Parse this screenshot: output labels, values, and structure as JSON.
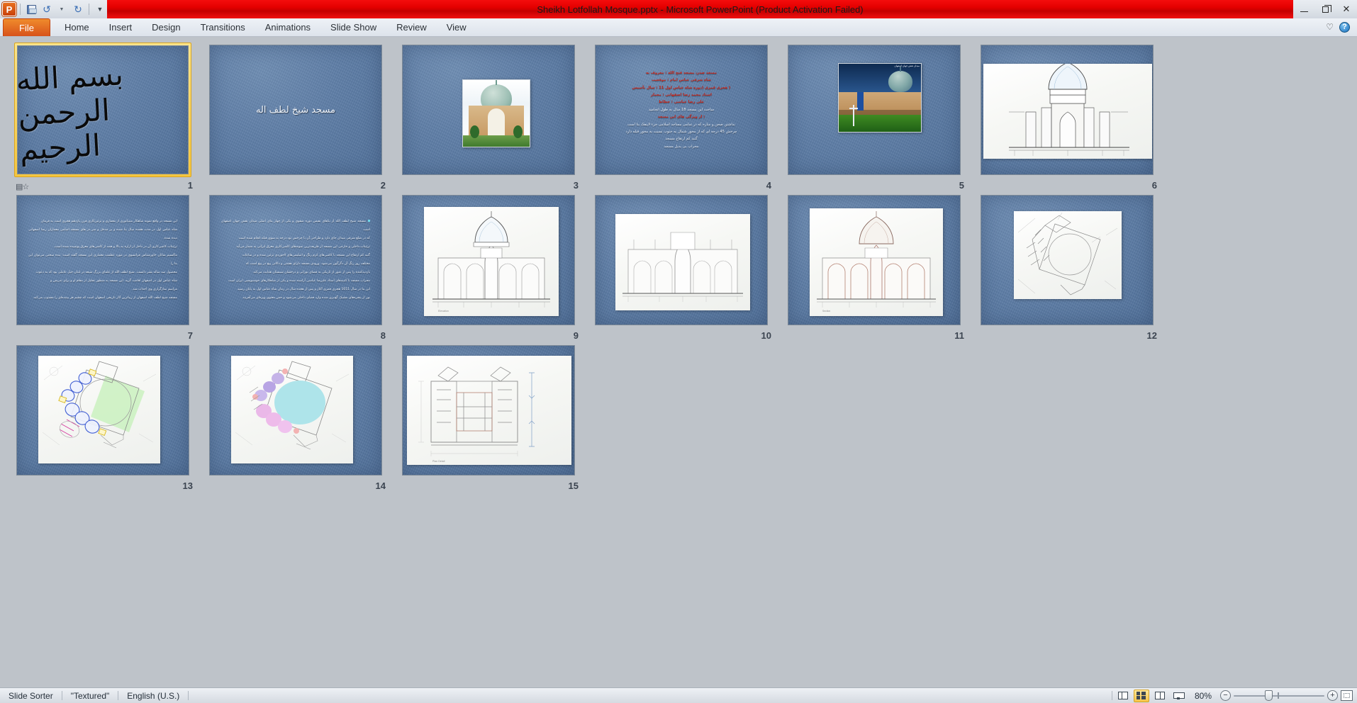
{
  "window": {
    "title": "Sheikh Lotfollah Mosque.pptx  -  Microsoft PowerPoint (Product Activation Failed)",
    "minimize_label": "Minimize",
    "restore_label": "Restore Down",
    "close_label": "Close",
    "titlebar_color": "#e40000"
  },
  "quick_access": {
    "logo_label": "P",
    "items": [
      {
        "name": "save-button",
        "label": "Save"
      },
      {
        "name": "undo-button",
        "label": "Undo"
      },
      {
        "name": "undo-dropdown",
        "label": "Undo options"
      },
      {
        "name": "repeat-button",
        "label": "Repeat"
      },
      {
        "name": "customize-qat-button",
        "label": "Customize Quick Access Toolbar"
      }
    ]
  },
  "ribbon": {
    "tabs": [
      {
        "label": "File",
        "active": false,
        "file": true
      },
      {
        "label": "Home",
        "active": false
      },
      {
        "label": "Insert",
        "active": false
      },
      {
        "label": "Design",
        "active": false
      },
      {
        "label": "Transitions",
        "active": false
      },
      {
        "label": "Animations",
        "active": false
      },
      {
        "label": "Slide Show",
        "active": false
      },
      {
        "label": "Review",
        "active": false
      },
      {
        "label": "View",
        "active": false
      }
    ],
    "minimize_ribbon_label": "Minimize the Ribbon",
    "help_label": "?"
  },
  "slides": [
    {
      "number": "1",
      "selected": true,
      "kind": "calligraphy",
      "text": "بسم الله الرحمن الرحیم",
      "has_animation": true
    },
    {
      "number": "2",
      "selected": false,
      "kind": "title",
      "text": "مسجد شیخ لطف اله"
    },
    {
      "number": "3",
      "selected": false,
      "kind": "photo-mosque",
      "text": ""
    },
    {
      "number": "4",
      "selected": false,
      "kind": "bullets-red",
      "lines": [
        {
          "text": "مسجد صدر، مسجد فتح الله : معروف به",
          "accent": "معروف به"
        },
        {
          "text": "شاه شرفی عباس امام : موقعیت",
          "accent": "موقعیت"
        },
        {
          "text": "( هجری قمری (دوره شاه عباس اول 11 : سال تأسیس",
          "accent": "سال تأسیس"
        },
        {
          "text": "استاد محمد رضا اصفهانی : معمار",
          "accent": "معمار"
        },
        {
          "text": "علی رضا عباسی : خطاط",
          "accent": "خطاط"
        },
        {
          "text": "ساخت این مسجد 18 سال به طول انجامید",
          "accent": ""
        },
        {
          "text": ": از ویژگی های این مسجد",
          "accent": ": از ویژگی های این مسجد"
        },
        {
          "text": "نداشتن صحن و مناره که در تمامی مساجد اسلامی جزء لاینفک بنا است",
          "accent": ""
        },
        {
          "text": "چرخش 45 درجه ای که از محور شمال به جنوب نسبت به محور قبله دارد",
          "accent": ""
        },
        {
          "text": "گنبد کم ارتفاع مسجد",
          "accent": ""
        },
        {
          "text": "محراب بی بدیل مسجد",
          "accent": ""
        }
      ]
    },
    {
      "number": "5",
      "selected": false,
      "kind": "photo-square",
      "caption": "میدان نقش جهان اصفهان"
    },
    {
      "number": "6",
      "selected": false,
      "kind": "drawing-elevation"
    },
    {
      "number": "7",
      "selected": false,
      "kind": "paragraph",
      "lines": [
        "این مسجد در واقع نمونه شاهکار مینیاتوری از معماری و تزئین‌کاری قرن یازدهم هجری است به فرمان",
        "شاه عباس اول در مدت هجده سال بنا شده و بر مدخل و سر در های مسجد اسامی معماران رضا اصفهانی دیده شده.",
        "تزئینات کاشی‌کاری آن در داخل از ازاره به بالا و همه از کاشی‌های معرق پوشیده شده است.",
        "ماکسیم شاتان خاورشناس فرانسوی در مورد عظمت معماری این مسجد گفته است: بنده سخنی می‌توان این بنا را",
        "محصول صد ساله بشر دانست. شیخ لطف الله از علمای بزرگ شیعه در لبنان جبل عاملی بود که به دعوت",
        "شاه عباس اول در اصفهان اقامت گزید. این مسجد به منظور تجلیل از مقام او و برای تدریس و",
        "مراسم نمازگزاری وی احداث شد.",
        "مسجد شیخ لطف الله اصفهان از زیباترین آثار تاریخی اصفهان است که چشم هر بیننده‌ای را مجذوب می‌کند."
      ]
    },
    {
      "number": "8",
      "selected": false,
      "kind": "paragraph-dense",
      "lines": [
        "مسجد شیخ لطف الله از بناهای نفیس دوره صفوی و یکی از چهار بنای اصلی میدان نقش جهان اصفهان است",
        "که در ضلع شرقی میدان جای دارد و طراحی آن با چرخش نود درجه به سوی قبله انجام شده است",
        "تزئینات داخلی و خارجی این مسجد از ظریف‌ترین نمونه‌های کاشی‌کاری معرق ایرانی به شمار می‌آید",
        "گنبد کم ارتفاع این مسجد با کاشی‌های کرم رنگ و اسلیمی‌های لاجوردی تزئین شده و در ساعات",
        "مختلف روز رنگ آن دگرگون می‌شود. ورودی مسجد دارای هشتی و دالانی پیچ در پیچ است که",
        "بازدیدکننده را پس از عبور از تاریکی به فضای نورانی و درخشان شبستان هدایت می‌کند",
        "محراب مسجد با کتیبه‌های استاد علیرضا عباسی آراسته شده و یکی از شاهکارهای خوشنویسی ایران است",
        "این بنا در سال 1011 هجری قمری آغاز و پس از هجده سال در زمان شاه عباس اول به پایان رسید",
        "نور از پنجره‌های مشبک گچ‌بری شده وارد فضای داخلی می‌شود و حس معنوی ویژه‌ای می‌آفریند"
      ]
    },
    {
      "number": "9",
      "selected": false,
      "kind": "drawing-facade"
    },
    {
      "number": "10",
      "selected": false,
      "kind": "drawing-facade2"
    },
    {
      "number": "11",
      "selected": false,
      "kind": "drawing-section"
    },
    {
      "number": "12",
      "selected": false,
      "kind": "plan-line"
    },
    {
      "number": "13",
      "selected": false,
      "kind": "plan-color"
    },
    {
      "number": "14",
      "selected": false,
      "kind": "plan-bubble"
    },
    {
      "number": "15",
      "selected": false,
      "kind": "drawing-plan-detail"
    }
  ],
  "status_bar": {
    "view_name": "Slide Sorter",
    "theme_name": "\"Textured\"",
    "language": "English (U.S.)",
    "zoom_level": "80%",
    "view_buttons": [
      {
        "name": "view-normal",
        "label": "Normal",
        "active": false
      },
      {
        "name": "view-slide-sorter",
        "label": "Slide Sorter",
        "active": true
      },
      {
        "name": "view-reading",
        "label": "Reading View",
        "active": false
      },
      {
        "name": "view-slideshow",
        "label": "Slide Show",
        "active": false
      }
    ],
    "zoom_out_label": "−",
    "zoom_in_label": "+",
    "fit_window_label": "Fit slide to current window"
  }
}
